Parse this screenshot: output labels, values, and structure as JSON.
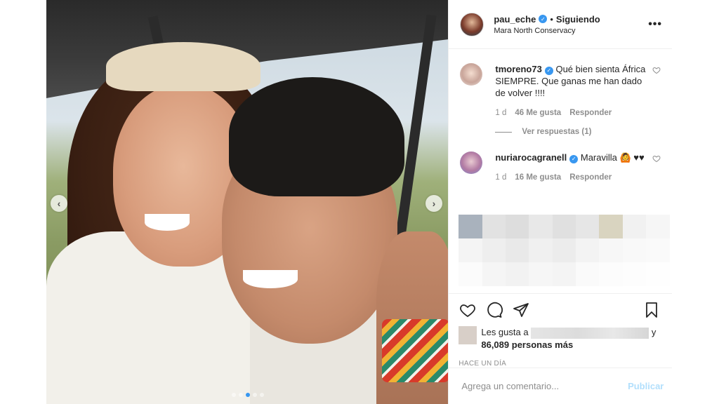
{
  "post": {
    "owner": {
      "username": "pau_eche",
      "avatar_icon": "profile-avatar",
      "verified": true,
      "separator": "•",
      "follow_status": "Siguiendo",
      "location": "Mara North Conservacy"
    },
    "more_icon": "ellipsis-icon",
    "more_label": "•••",
    "photo": {
      "description_icon": "couple-selfie-photo",
      "prev_arrow": "‹",
      "next_arrow": "›",
      "carousel": {
        "count": 5,
        "active": 3
      }
    }
  },
  "comments": [
    {
      "username": "tmoreno73",
      "verified": true,
      "text": "Qué bien sienta África SIEMPRE. Que ganas me han dado de volver !!!!",
      "age": "1 d",
      "likes": "46 Me gusta",
      "reply": "Responder",
      "view_replies": "Ver respuestas (1)"
    },
    {
      "username": "nuriarocagranell",
      "verified": true,
      "text": "Maravilla 🙆 ♥♥",
      "age": "1 d",
      "likes": "16 Me gusta",
      "reply": "Responder"
    }
  ],
  "actions": {
    "like_icon": "heart-icon",
    "comment_icon": "comment-icon",
    "share_icon": "share-icon",
    "save_icon": "bookmark-icon"
  },
  "likes_summary": {
    "prefix": "Les gusta a",
    "and": "y",
    "count": "86,089",
    "suffix": "personas más"
  },
  "timestamp": "HACE UN DÍA",
  "add_comment": {
    "placeholder": "Agrega un comentario...",
    "submit": "Publicar"
  },
  "colors": {
    "verified": "#3897f0",
    "muted_text": "#8e8e8e",
    "publish_disabled": "#b2dffc",
    "border": "#efefef"
  },
  "blurred_cells": [
    "#a9b2bd",
    "#e2e2e2",
    "#dddddd",
    "#e8e8e8",
    "#e0e0e0",
    "#e6e6e6",
    "#d9d4c0",
    "#f1f1f1",
    "#f6f6f6",
    "#f4f4f4",
    "#eeeeee",
    "#e9e9e9",
    "#f0f0f0",
    "#ececec",
    "#f3f3f3",
    "#f7f7f7",
    "#f9f9f9",
    "#fafafa",
    "#fbfbfb",
    "#f5f5f5",
    "#f2f2f2",
    "#f6f6f6",
    "#f4f4f4",
    "#fafafa",
    "#fcfcfc",
    "#fdfdfd",
    "#fefefe"
  ]
}
